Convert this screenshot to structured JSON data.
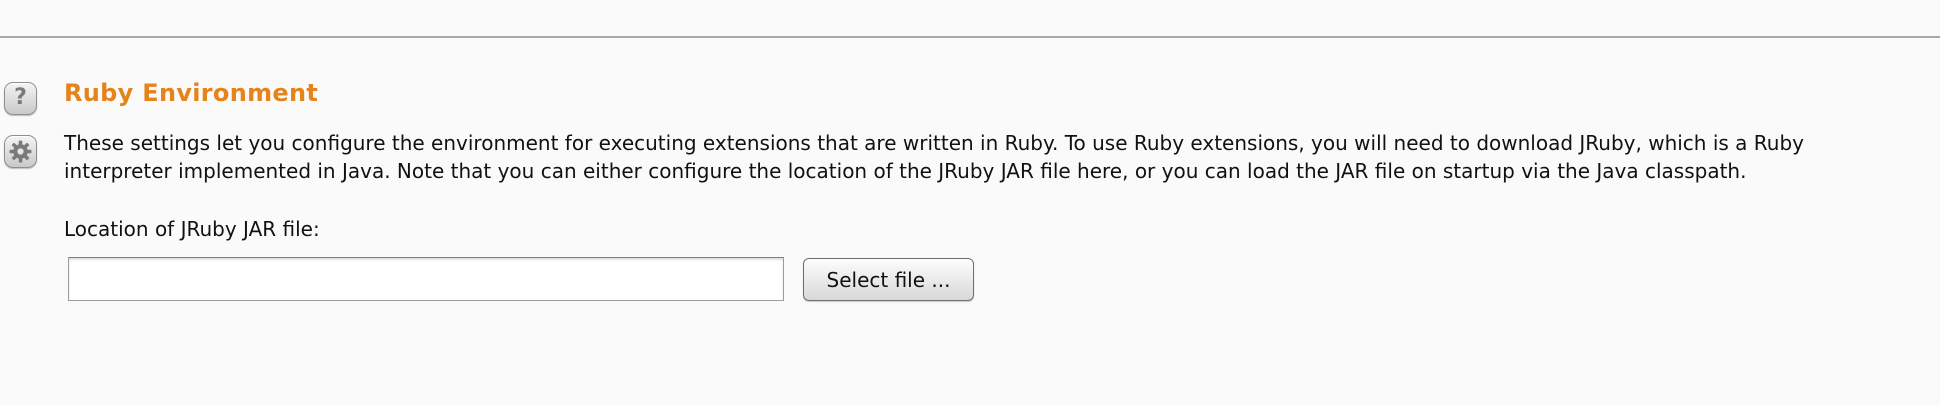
{
  "section": {
    "title": "Ruby Environment",
    "description": "These settings let you configure the environment for executing extensions that are written in Ruby. To use Ruby extensions, you will need to download JRuby, which is a Ruby interpreter implemented in Java. Note that you can either configure the location of the JRuby JAR file here, or you can load the JAR file on startup via the Java classpath."
  },
  "jar_location": {
    "label": "Location of JRuby JAR file:",
    "value": "",
    "button_label": "Select file ..."
  },
  "icons": {
    "help": "help-icon",
    "settings": "gear-icon",
    "help_glyph": "?"
  },
  "colors": {
    "title": "#e5841a",
    "background": "#fafafa",
    "divider": "#a7a7ad"
  }
}
